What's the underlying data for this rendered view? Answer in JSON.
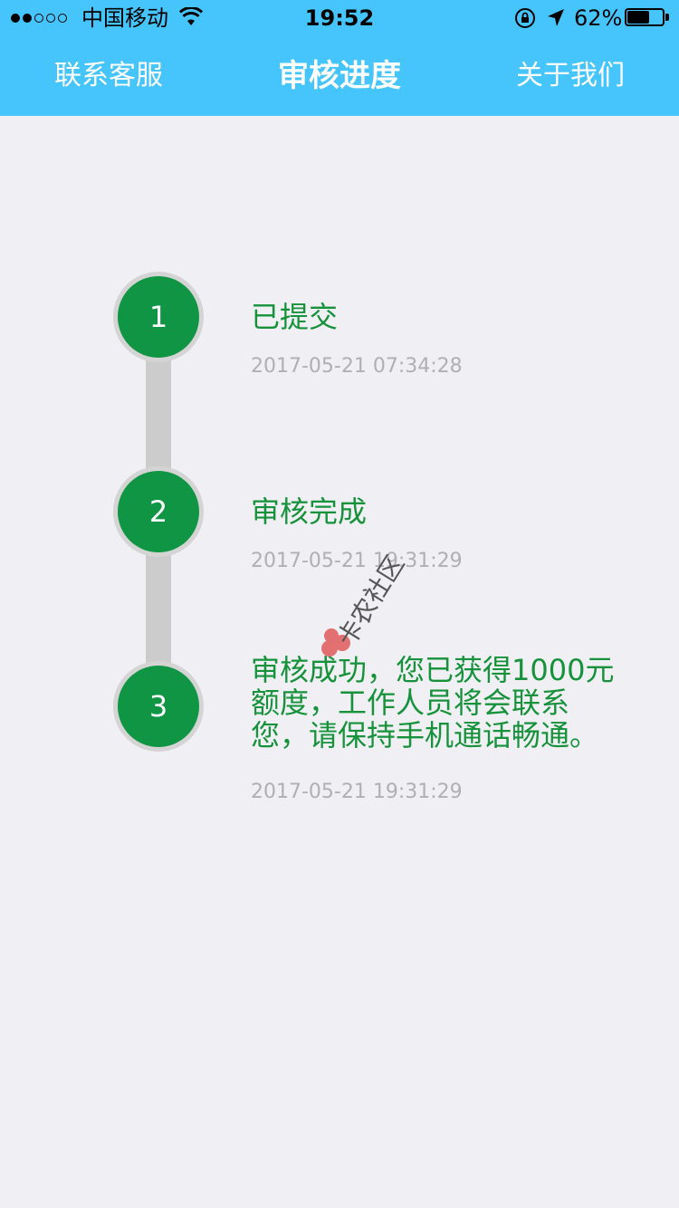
{
  "status_bar": {
    "carrier": "中国移动",
    "time": "19:52",
    "battery_percent": "62%",
    "battery_level": 0.62,
    "signal_bars_filled": 2,
    "signal_bars_total": 5
  },
  "nav": {
    "left_label": "联系客服",
    "title": "审核进度",
    "right_label": "关于我们"
  },
  "steps": [
    {
      "number": "1",
      "title": "已提交",
      "time": "2017-05-21 07:34:28"
    },
    {
      "number": "2",
      "title": "审核完成",
      "time": "2017-05-21 19:31:29"
    },
    {
      "number": "3",
      "title_lines": [
        "审核成功，您已获得1000元",
        "额度，工作人员将会联系",
        "您，请保持手机通话畅通。"
      ],
      "time": "2017-05-21 19:31:29"
    }
  ],
  "watermark": {
    "text": "卡农社区"
  },
  "colors": {
    "header": "#45c5fb",
    "background": "#efeff4",
    "node": "#0f9543",
    "step_text": "#16923a",
    "time_text": "#b0b0b4"
  }
}
